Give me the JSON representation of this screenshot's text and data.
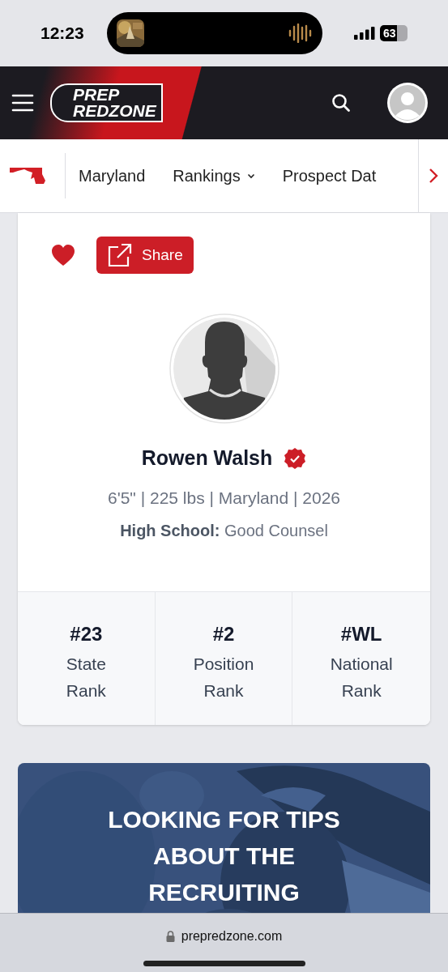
{
  "status_bar": {
    "time": "12:23",
    "battery": "63"
  },
  "header": {
    "logo": [
      "PREP",
      "REDZONE"
    ]
  },
  "nav": {
    "items": [
      {
        "label": "Maryland",
        "dropdown": false
      },
      {
        "label": "Rankings",
        "dropdown": true
      },
      {
        "label": "Prospect Dat",
        "dropdown": false
      }
    ]
  },
  "profile": {
    "favorited": true,
    "share_label": "Share",
    "name": "Rowen Walsh",
    "verified": true,
    "details": "6'5\" | 225 lbs | Maryland | 2026",
    "school_label": "High School:",
    "school": "Good Counsel",
    "stats": [
      {
        "value": "#23",
        "label": "State Rank"
      },
      {
        "value": "#2",
        "label": "Position Rank"
      },
      {
        "value": "#WL",
        "label": "National Rank"
      }
    ]
  },
  "promo": {
    "kind": "picture",
    "title": "LOOKING FOR TIPS ABOUT THE RECRUITING"
  },
  "browser": {
    "url": "prepredzone.com"
  }
}
